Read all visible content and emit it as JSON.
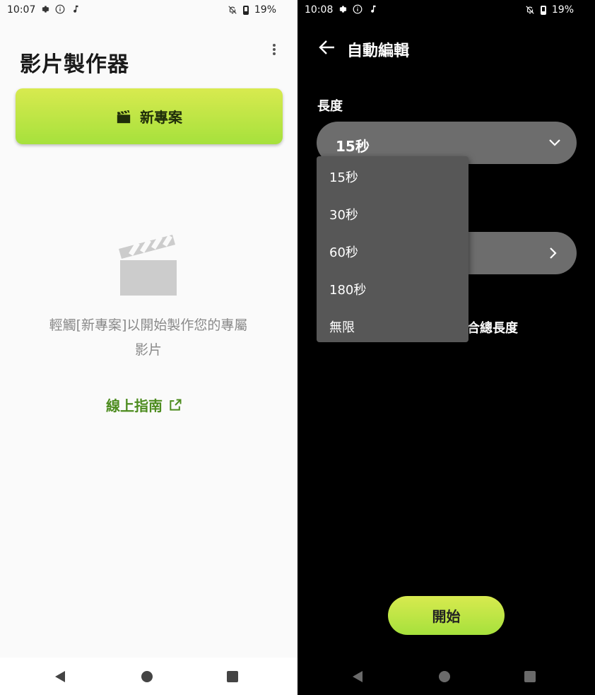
{
  "left": {
    "status": {
      "time": "10:07",
      "battery": "19%"
    },
    "title": "影片製作器",
    "new_project_label": "新專案",
    "hint_line1": "輕觸[新專案]以開始製作您的專屬",
    "hint_line2": "影片",
    "guide_link": "線上指南",
    "accent": "#a6e13c",
    "link_color": "#4d8c1f"
  },
  "right": {
    "status": {
      "time": "10:08",
      "battery": "19%"
    },
    "title": "自動編輯",
    "length_label": "長度",
    "length_value": "15秒",
    "dropdown_options": [
      "15秒",
      "30秒",
      "60秒",
      "180秒",
      "無限"
    ],
    "partial_text": "合總長度",
    "start_label": "開始"
  }
}
